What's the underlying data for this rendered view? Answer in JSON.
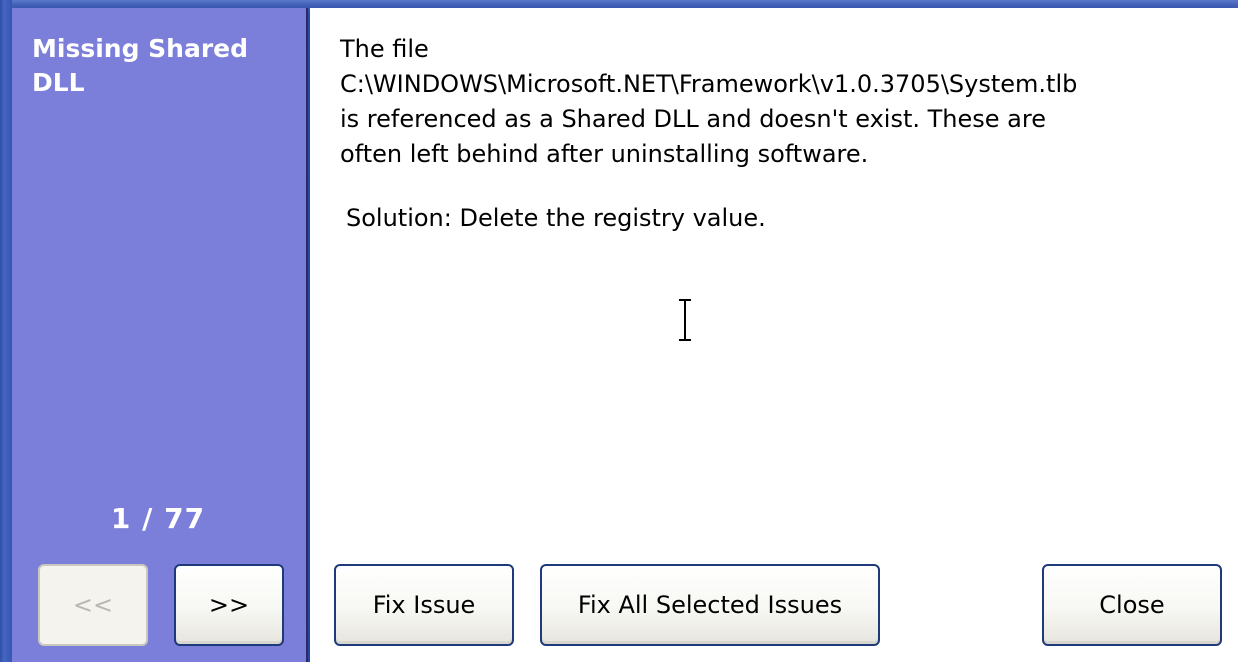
{
  "sidebar": {
    "title": "Missing Shared DLL",
    "counter": "1 / 77",
    "prev_label": "<<",
    "next_label": ">>"
  },
  "content": {
    "line1": "The file",
    "path": "C:\\WINDOWS\\Microsoft.NET\\Framework\\v1.0.3705\\System.tlb",
    "line3": "is referenced as a Shared DLL and doesn't exist. These are",
    "line4": "often left behind after uninstalling software.",
    "solution": "Solution: Delete the registry value."
  },
  "buttons": {
    "fix_issue": "Fix Issue",
    "fix_all": "Fix All Selected Issues",
    "close": "Close"
  },
  "colors": {
    "sidebar_bg": "#7b7fd9",
    "frame": "#2545a0",
    "content_bg": "#ffffff"
  }
}
